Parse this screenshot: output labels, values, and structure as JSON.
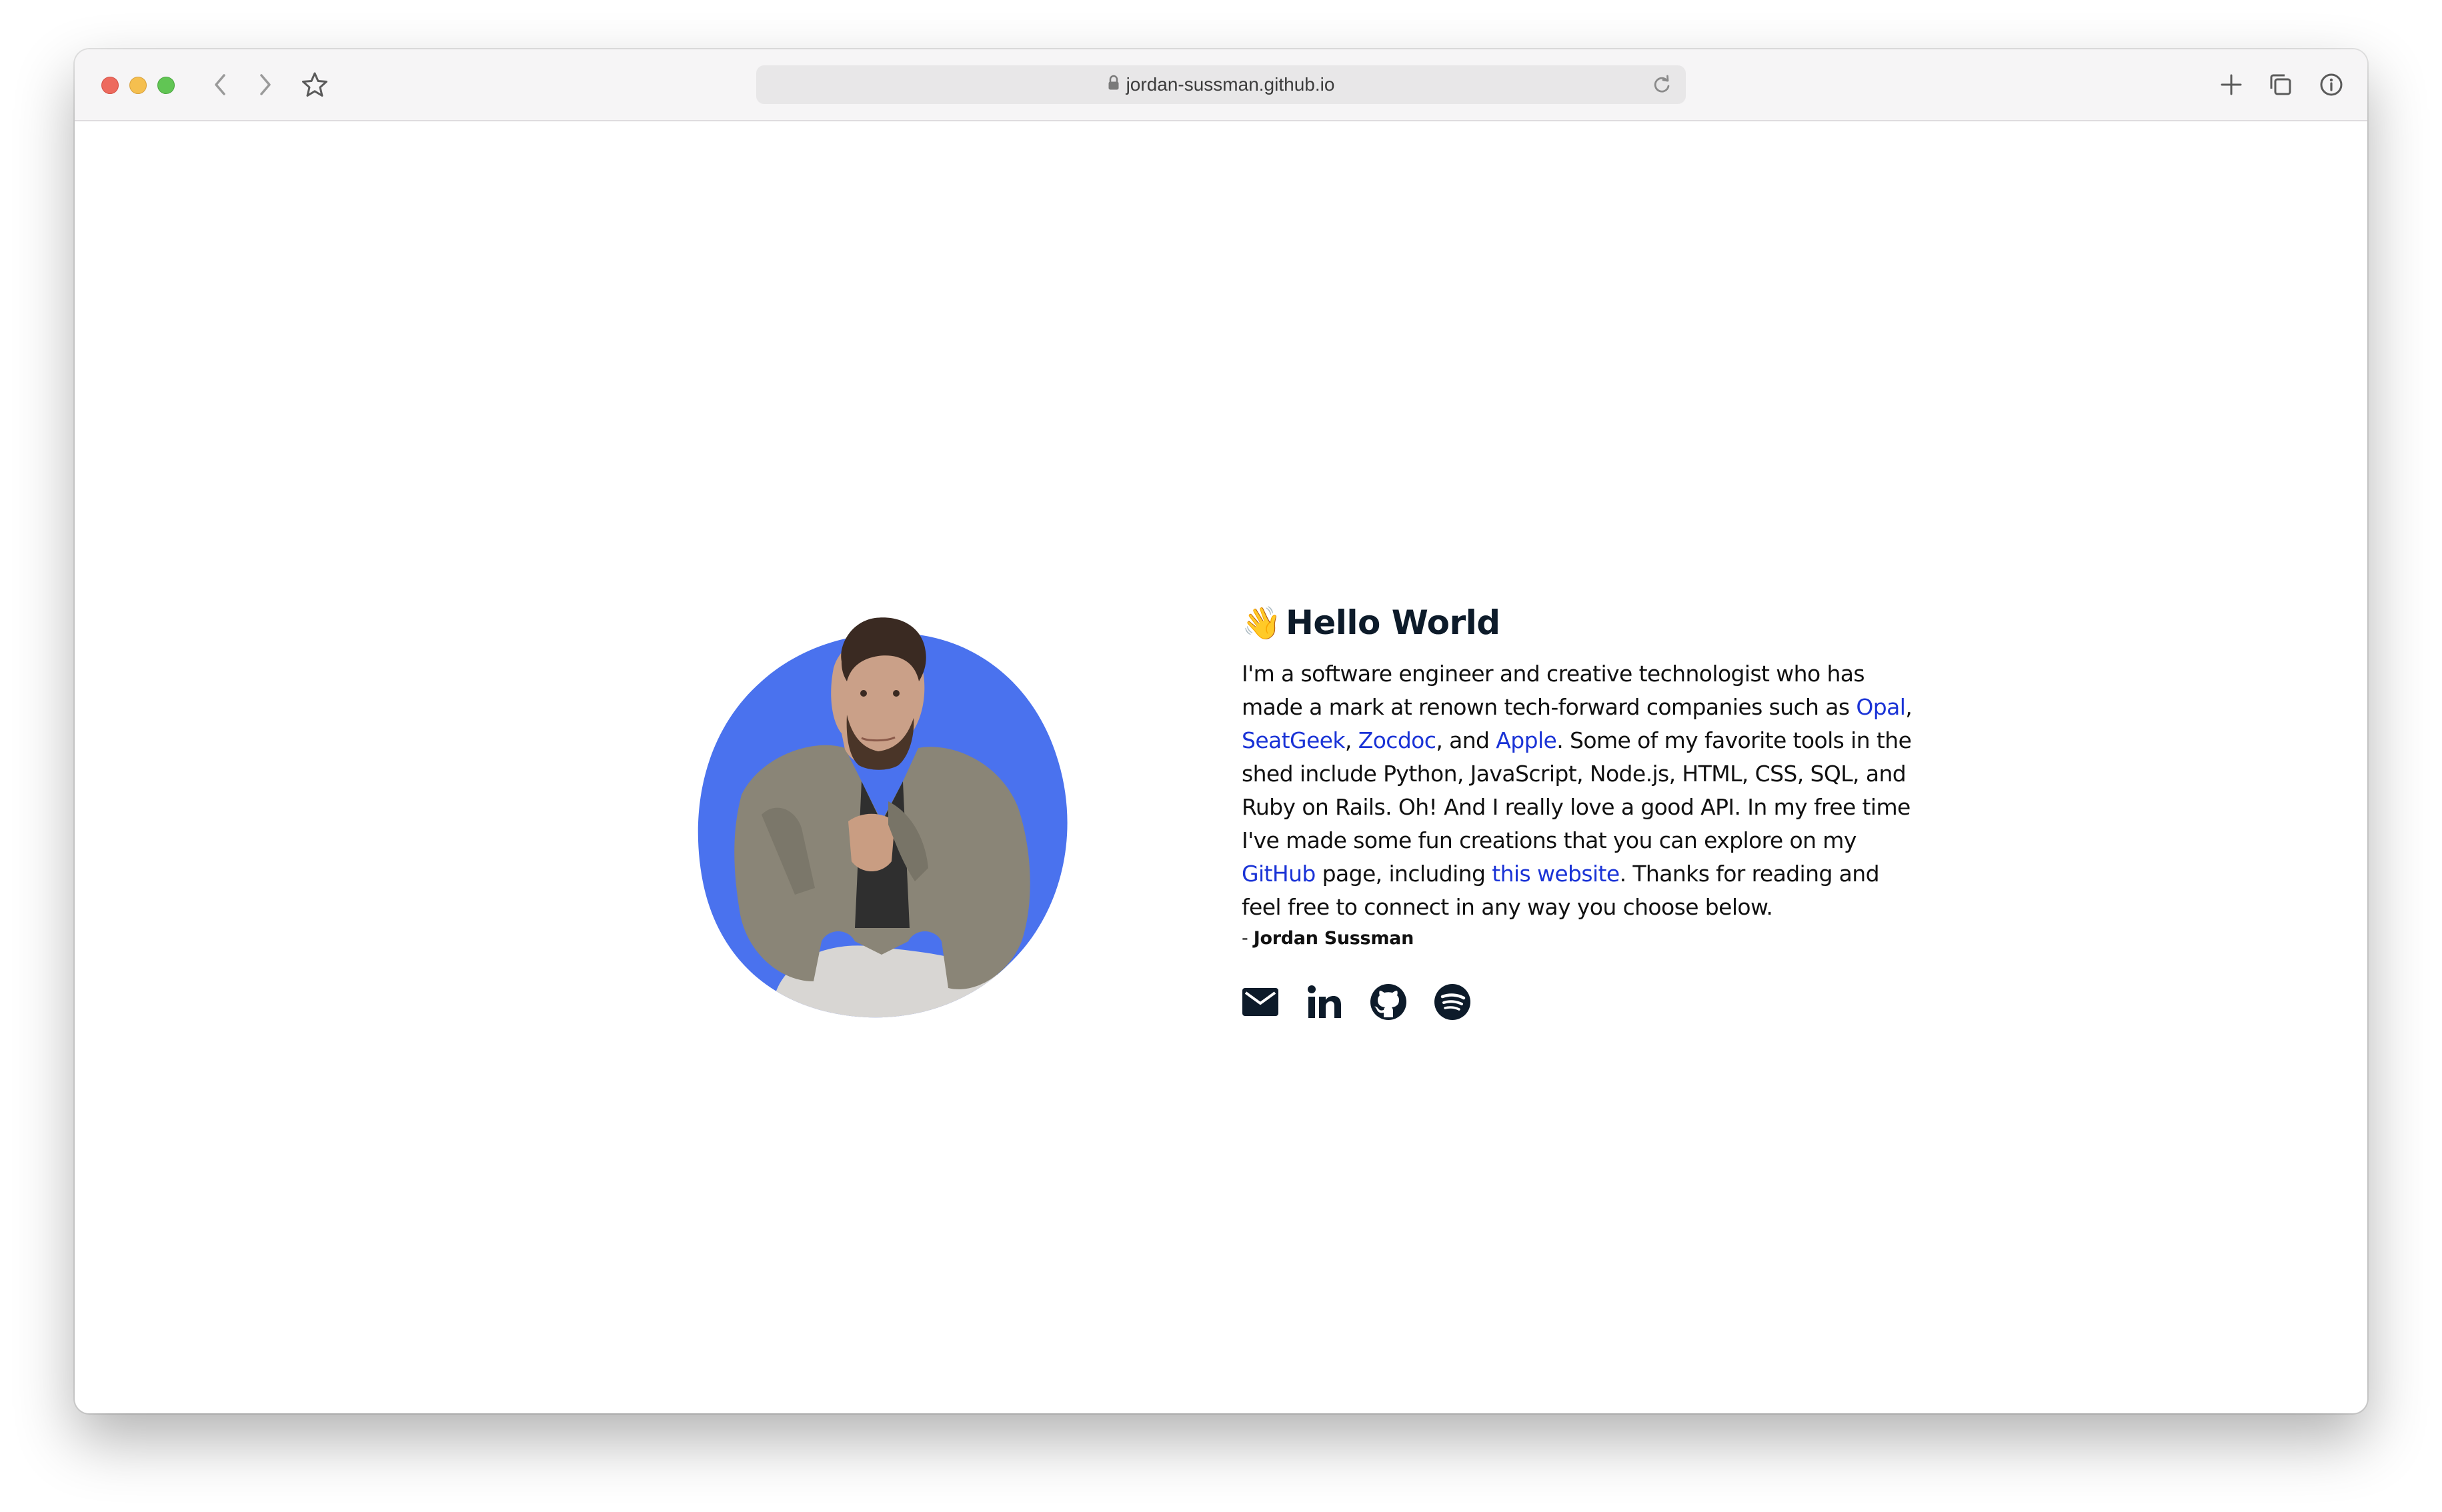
{
  "browser": {
    "url": "jordan-sussman.github.io",
    "icons": [
      "back-icon",
      "forward-icon",
      "bookmark-star-icon",
      "lock-icon",
      "reload-icon",
      "new-tab-icon",
      "tabs-overview-icon",
      "info-icon"
    ]
  },
  "hero": {
    "wave_emoji": "👋",
    "title": "Hello World",
    "bio": {
      "p1": "I'm a software engineer and creative technologist who has made a mark at renown tech-forward companies such as ",
      "link_opal": "Opal",
      "sep1": ", ",
      "link_seatgeek": "SeatGeek",
      "sep2": ", ",
      "link_zocdoc": "Zocdoc",
      "sep3": ", and ",
      "link_apple": "Apple",
      "p2": ". Some of my favorite tools in the shed include Python, JavaScript, Node.js, HTML, CSS, SQL, and Ruby on Rails. Oh! And I really love a good API. In my free time I've made some fun creations that you can explore on my ",
      "link_github": "GitHub",
      "p3": " page, including ",
      "link_website": "this website",
      "p4": ". Thanks for reading and feel free to connect in any way you choose below."
    },
    "signature_prefix": "- ",
    "signature_name": "Jordan Sussman",
    "socials": [
      "email-icon",
      "linkedin-icon",
      "github-icon",
      "spotify-icon"
    ]
  },
  "colors": {
    "blob": "#4a72ee",
    "link": "#1a33d6",
    "heading": "#0d1b2a"
  }
}
